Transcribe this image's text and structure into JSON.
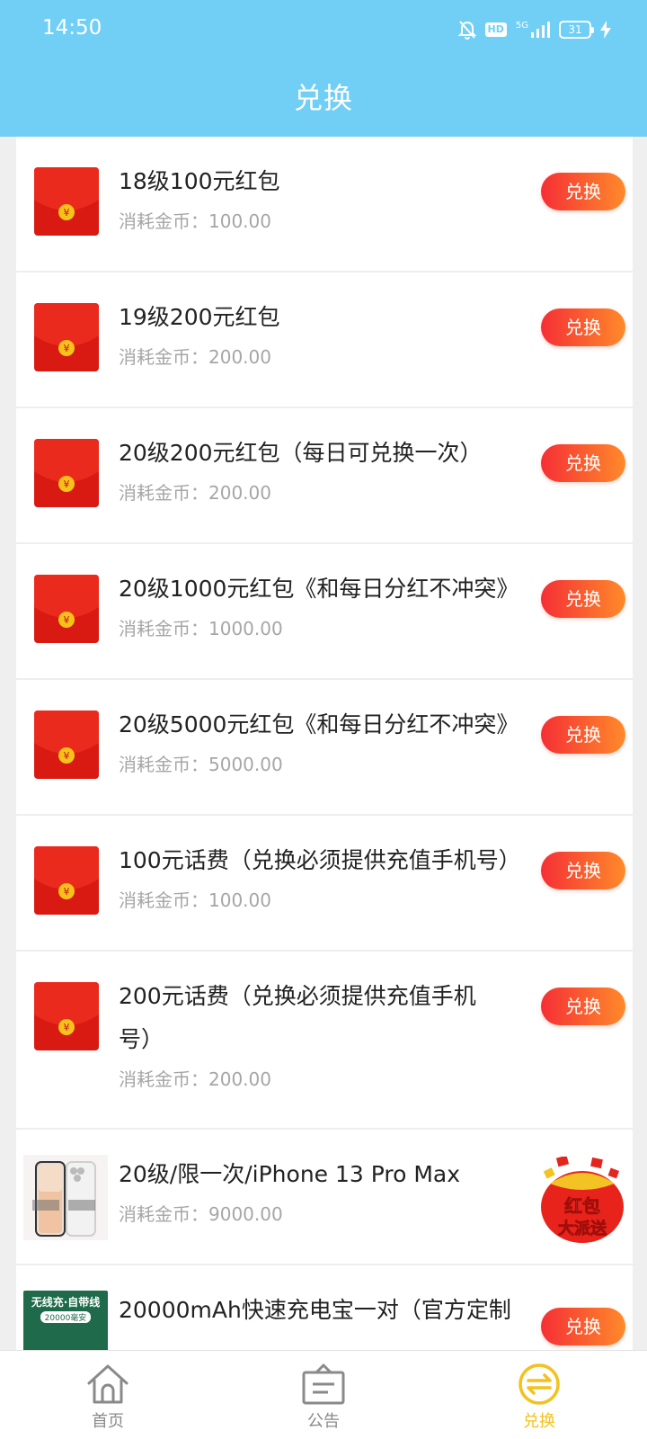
{
  "status_bar": {
    "time": "14:50",
    "network": "5G",
    "hd": "HD",
    "battery": "31"
  },
  "header": {
    "title": "兑换"
  },
  "cost_label": "消耗金币：",
  "redeem_label": "兑换",
  "items": [
    {
      "title": "18级100元红包",
      "cost": "100.00",
      "thumb": "red-packet"
    },
    {
      "title": "19级200元红包",
      "cost": "200.00",
      "thumb": "red-packet"
    },
    {
      "title": "20级200元红包（每日可兑换一次）",
      "cost": "200.00",
      "thumb": "red-packet"
    },
    {
      "title": "20级1000元红包《和每日分红不冲突》",
      "cost": "1000.00",
      "thumb": "red-packet"
    },
    {
      "title": "20级5000元红包《和每日分红不冲突》",
      "cost": "5000.00",
      "thumb": "red-packet"
    },
    {
      "title": "100元话费（兑换必须提供充值手机号）",
      "cost": "100.00",
      "thumb": "red-packet"
    },
    {
      "title": "200元话费（兑换必须提供充值手机号）",
      "cost": "200.00",
      "thumb": "red-packet"
    },
    {
      "title": "20级/限一次/iPhone 13 Pro Max",
      "cost": "9000.00",
      "thumb": "iphone-photo",
      "promo": {
        "line1": "红包",
        "line2": "大派送"
      }
    },
    {
      "title": "20000mAh快速充电宝一对（官方定制",
      "cost": "",
      "thumb": "power-bank-photo",
      "thumb_text": {
        "line1": "无线充·自带线",
        "line2": "20000毫安"
      }
    }
  ],
  "nav": [
    {
      "label": "首页",
      "icon": "home-icon",
      "active": false
    },
    {
      "label": "公告",
      "icon": "notice-board-icon",
      "active": false
    },
    {
      "label": "兑换",
      "icon": "exchange-icon",
      "active": true
    }
  ],
  "colors": {
    "header_bg": "#71cff5",
    "button_gradient_start": "#f52f35",
    "button_gradient_end": "#ff8a2a",
    "active_nav": "#f5c11c"
  }
}
